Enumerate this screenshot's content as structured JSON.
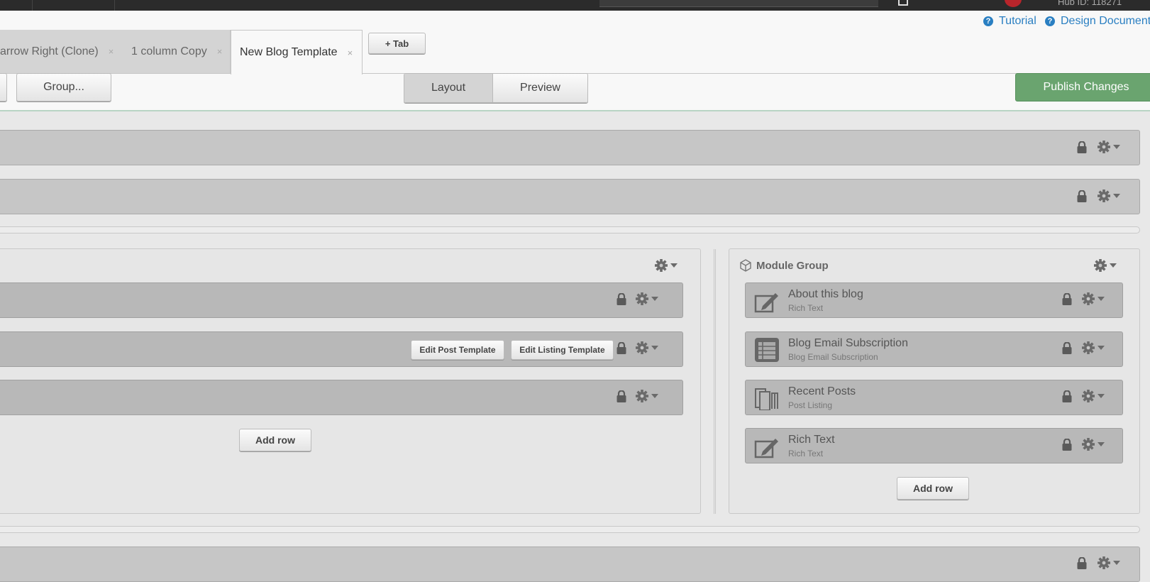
{
  "topbar": {
    "hub_id": "Hub ID: 118271"
  },
  "help": {
    "tutorial": "Tutorial",
    "docs": "Design Documentation"
  },
  "tabs": [
    {
      "label": "arrow Right (Clone)",
      "close": "×"
    },
    {
      "label": "1 column Copy",
      "close": "×"
    },
    {
      "label": "New Blog Template",
      "close": "×"
    }
  ],
  "add_tab": "+ Tab",
  "toolbar": {
    "group": "Group...",
    "layout": "Layout",
    "preview": "Preview",
    "publish": "Publish Changes"
  },
  "main": {
    "modules": [
      {
        "edit_post": "Edit Post Template",
        "edit_listing": "Edit Listing Template"
      }
    ],
    "add_row": "Add row"
  },
  "sidebar": {
    "title": "Module Group",
    "modules": [
      {
        "title": "About this blog",
        "type": "Rich Text",
        "icon": "edit-icon"
      },
      {
        "title": "Blog Email Subscription",
        "type": "Blog Email Subscription",
        "icon": "list-icon"
      },
      {
        "title": "Recent Posts",
        "type": "Post Listing",
        "icon": "posts-icon"
      },
      {
        "title": "Rich Text",
        "type": "Rich Text",
        "icon": "edit-icon"
      }
    ],
    "add_row": "Add row"
  },
  "colors": {
    "publish": "#6aa46f",
    "link": "#2a7fc2",
    "row": "#c6c6c6",
    "module": "#b8b8b8"
  }
}
